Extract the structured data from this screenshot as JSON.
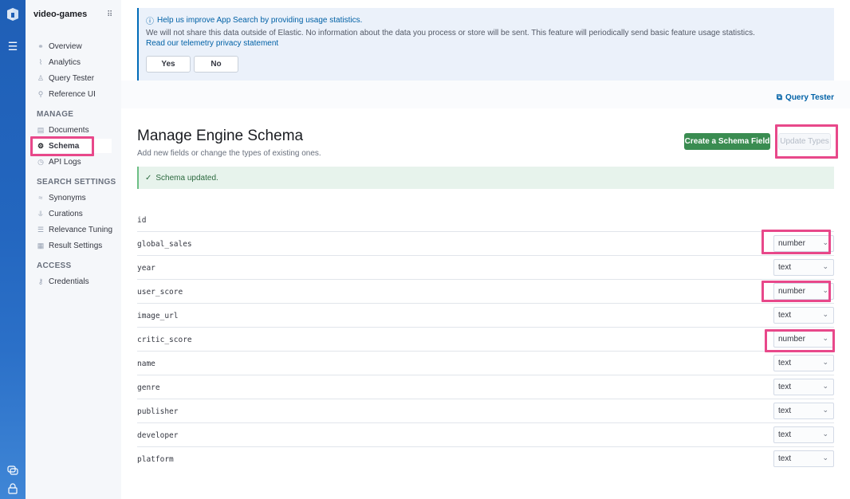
{
  "sidebar": {
    "engine_name": "video-games",
    "items_top": [
      {
        "label": "Overview",
        "icon": "overview-icon",
        "glyph": "⚭"
      },
      {
        "label": "Analytics",
        "icon": "analytics-icon",
        "glyph": "⌇"
      },
      {
        "label": "Query Tester",
        "icon": "query-tester-icon",
        "glyph": "♙"
      },
      {
        "label": "Reference UI",
        "icon": "reference-ui-icon",
        "glyph": "⚲"
      }
    ],
    "manage_heading": "MANAGE",
    "items_manage": [
      {
        "label": "Documents",
        "icon": "documents-icon",
        "glyph": "▤"
      },
      {
        "label": "Schema",
        "icon": "schema-gear-icon",
        "glyph": "⚙"
      },
      {
        "label": "API Logs",
        "icon": "api-logs-icon",
        "glyph": "◷"
      }
    ],
    "search_settings_heading": "SEARCH SETTINGS",
    "items_search": [
      {
        "label": "Synonyms",
        "icon": "synonyms-icon",
        "glyph": "≈"
      },
      {
        "label": "Curations",
        "icon": "curations-icon",
        "glyph": "⥥"
      },
      {
        "label": "Relevance Tuning",
        "icon": "relevance-tuning-icon",
        "glyph": "☰"
      },
      {
        "label": "Result Settings",
        "icon": "result-settings-icon",
        "glyph": "▦"
      }
    ],
    "access_heading": "ACCESS",
    "items_access": [
      {
        "label": "Credentials",
        "icon": "credentials-icon",
        "glyph": "⚷"
      }
    ]
  },
  "telemetry": {
    "title": "Help us improve App Search by providing usage statistics.",
    "body": "We will not share this data outside of Elastic. No information about the data you process or store will be sent. This feature will periodically send basic feature usage statistics.",
    "link": "Read our telemetry privacy statement",
    "yes_label": "Yes",
    "no_label": "No"
  },
  "toolbar": {
    "query_tester_label": "Query Tester"
  },
  "page": {
    "title": "Manage Engine Schema",
    "subtitle": "Add new fields or change the types of existing ones.",
    "create_button": "Create a Schema Field",
    "update_button": "Update Types",
    "success_message": "Schema updated."
  },
  "schema": {
    "fields": [
      {
        "name": "id",
        "type": null
      },
      {
        "name": "global_sales",
        "type": "number"
      },
      {
        "name": "year",
        "type": "text"
      },
      {
        "name": "user_score",
        "type": "number"
      },
      {
        "name": "image_url",
        "type": "text"
      },
      {
        "name": "critic_score",
        "type": "number"
      },
      {
        "name": "name",
        "type": "text"
      },
      {
        "name": "genre",
        "type": "text"
      },
      {
        "name": "publisher",
        "type": "text"
      },
      {
        "name": "developer",
        "type": "text"
      },
      {
        "name": "platform",
        "type": "text"
      }
    ]
  },
  "colors": {
    "highlight": "#e8488a",
    "primary_link": "#0061a6",
    "success_button": "#3a8c51",
    "rail": "#2366bf"
  }
}
